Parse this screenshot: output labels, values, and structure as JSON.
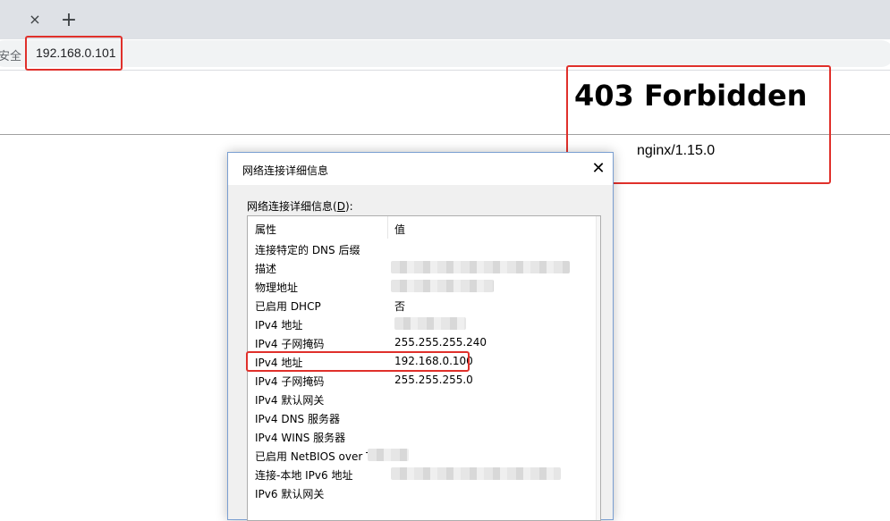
{
  "browser": {
    "tab_close_glyph": "×",
    "new_tab_glyph": "+",
    "security_label": "安全",
    "url": "192.168.0.101"
  },
  "page": {
    "heading": "403 Forbidden",
    "server": "nginx/1.15.0"
  },
  "dialog": {
    "title": "网络连接详细信息",
    "close_glyph": "✕",
    "label": "网络连接详细信息(",
    "label_mnemonic": "D",
    "label_tail": "):",
    "columns": {
      "property": "属性",
      "value": "值"
    },
    "rows": [
      {
        "property": "连接特定的 DNS 后缀",
        "value": ""
      },
      {
        "property": "描述",
        "value": ""
      },
      {
        "property": "物理地址",
        "value": ""
      },
      {
        "property": "已启用 DHCP",
        "value": "否"
      },
      {
        "property": "IPv4 地址",
        "value": ""
      },
      {
        "property": "IPv4 子网掩码",
        "value": "255.255.255.240"
      },
      {
        "property": "IPv4 地址",
        "value": "192.168.0.100"
      },
      {
        "property": "IPv4 子网掩码",
        "value": "255.255.255.0"
      },
      {
        "property": "IPv4 默认网关",
        "value": ""
      },
      {
        "property": "IPv4 DNS 服务器",
        "value": ""
      },
      {
        "property": "IPv4 WINS 服务器",
        "value": ""
      },
      {
        "property": "已启用 NetBIOS over T",
        "value": ""
      },
      {
        "property": "连接-本地 IPv6 地址",
        "value": ""
      },
      {
        "property": "IPv6 默认网关",
        "value": ""
      }
    ]
  },
  "colors": {
    "highlight": "#e0302b"
  }
}
